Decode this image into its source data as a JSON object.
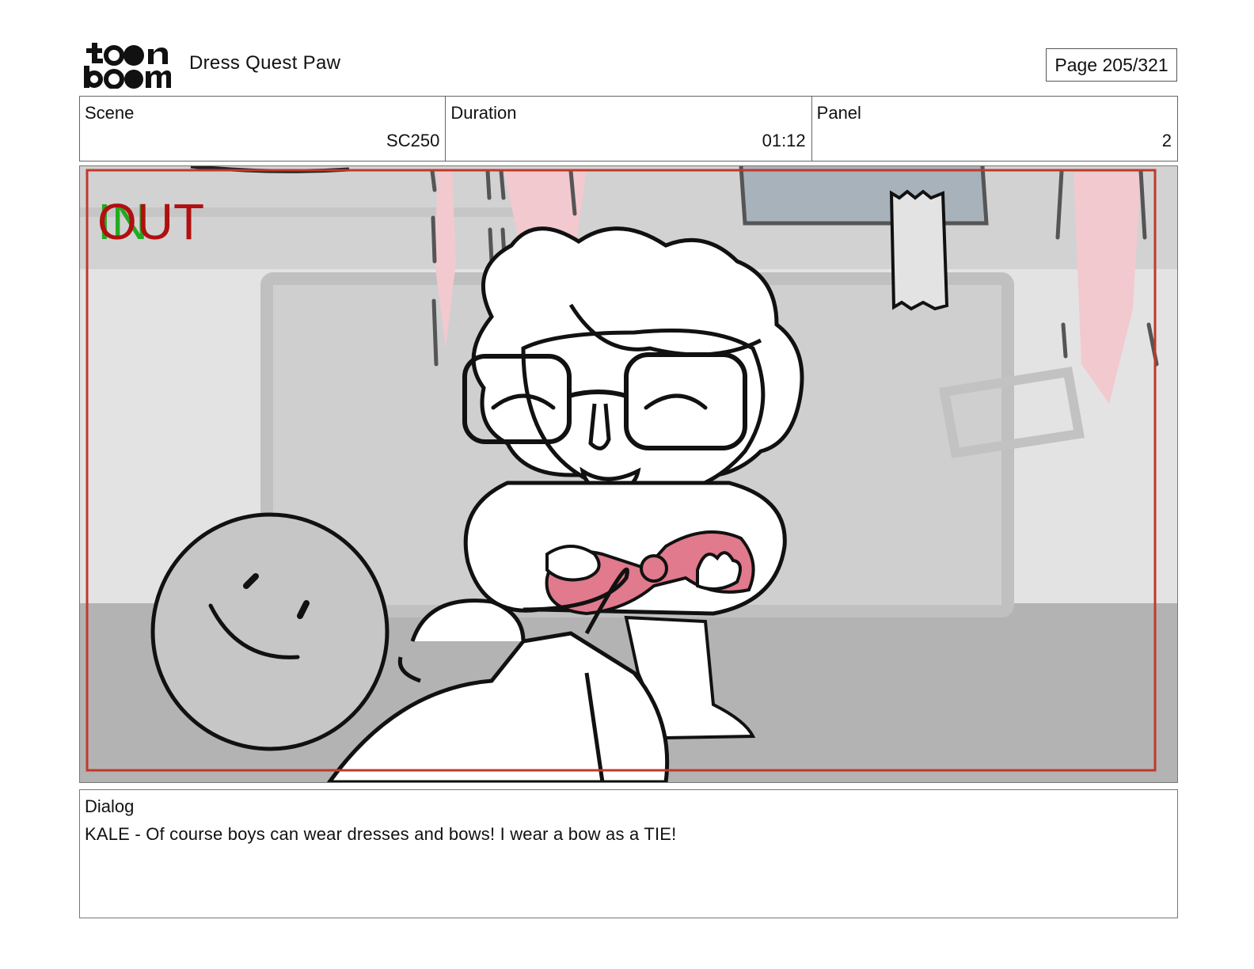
{
  "header": {
    "logo_text": "toonboom",
    "project_title": "Dress Quest Paw",
    "page_label": "Page 205/321"
  },
  "info": {
    "scene_label": "Scene",
    "scene_value": "SC250",
    "duration_label": "Duration",
    "duration_value": "01:12",
    "panel_label": "Panel",
    "panel_value": "2"
  },
  "panel_image": {
    "in_marker": "IN",
    "out_marker": "OUT",
    "colors": {
      "in_marker": "#22aa22",
      "out_marker": "#b01010",
      "safe_frame": "#c0392b",
      "bow": "#e07a8c",
      "curtain": "#f2c9cf"
    }
  },
  "dialog": {
    "label": "Dialog",
    "text": "KALE - Of course boys can wear dresses and bows! I wear a bow as a TIE!"
  }
}
